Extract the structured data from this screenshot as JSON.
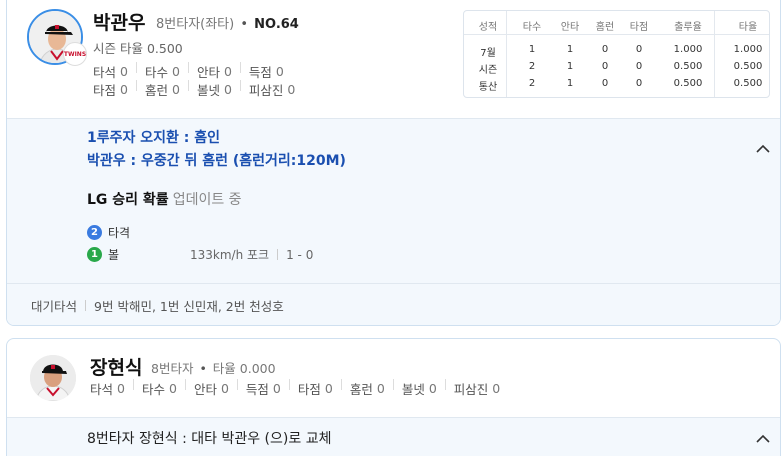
{
  "batter1": {
    "name": "박관우",
    "position": "8번타자(좌타)",
    "dot": "•",
    "number": "NO.64",
    "season_avg": "시즌 타율 0.500",
    "team_logo_text": "TWINS",
    "stats_row1": [
      {
        "label": "타석",
        "value": "0"
      },
      {
        "label": "타수",
        "value": "0"
      },
      {
        "label": "안타",
        "value": "0"
      },
      {
        "label": "득점",
        "value": "0"
      }
    ],
    "stats_row2": [
      {
        "label": "타점",
        "value": "0"
      },
      {
        "label": "홈런",
        "value": "0"
      },
      {
        "label": "볼넷",
        "value": "0"
      },
      {
        "label": "피삼진",
        "value": "0"
      }
    ]
  },
  "record_table": {
    "headers": [
      "성적",
      "타수",
      "안타",
      "홈런",
      "타점",
      "출루율",
      "타율"
    ],
    "rows": [
      [
        "7월",
        "1",
        "1",
        "0",
        "0",
        "1.000",
        "1.000"
      ],
      [
        "시즌",
        "2",
        "1",
        "0",
        "0",
        "0.500",
        "0.500"
      ],
      [
        "통산",
        "2",
        "1",
        "0",
        "0",
        "0.500",
        "0.500"
      ]
    ]
  },
  "play": {
    "line1": "1루주자 오지환 : 홈인",
    "line2": "박관우 : 우중간 뒤 홈런 (홈런거리:120M)",
    "prob_label": "LG 승리 확률",
    "prob_status": "업데이트 중",
    "pitches": [
      {
        "num": "2",
        "result": "타격",
        "detail": [],
        "color": "#3a7be0"
      },
      {
        "num": "1",
        "result": "볼",
        "detail": [
          "133km/h 포크",
          "1 - 0"
        ],
        "color": "#29a84a"
      }
    ]
  },
  "waiting": {
    "label": "대기타석",
    "players": "9번 박해민, 1번 신민재, 2번 천성호"
  },
  "batter2": {
    "name": "장현식",
    "position": "8번타자",
    "dot": "•",
    "avg": "타율 0.000",
    "stats": [
      {
        "label": "타석",
        "value": "0"
      },
      {
        "label": "타수",
        "value": "0"
      },
      {
        "label": "안타",
        "value": "0"
      },
      {
        "label": "득점",
        "value": "0"
      },
      {
        "label": "타점",
        "value": "0"
      },
      {
        "label": "홈런",
        "value": "0"
      },
      {
        "label": "볼넷",
        "value": "0"
      },
      {
        "label": "피삼진",
        "value": "0"
      }
    ],
    "substitution": "8번타자 장현식 : 대타 박관우 (으)로 교체"
  },
  "icons": {
    "collapse": "chevron-up-icon"
  }
}
